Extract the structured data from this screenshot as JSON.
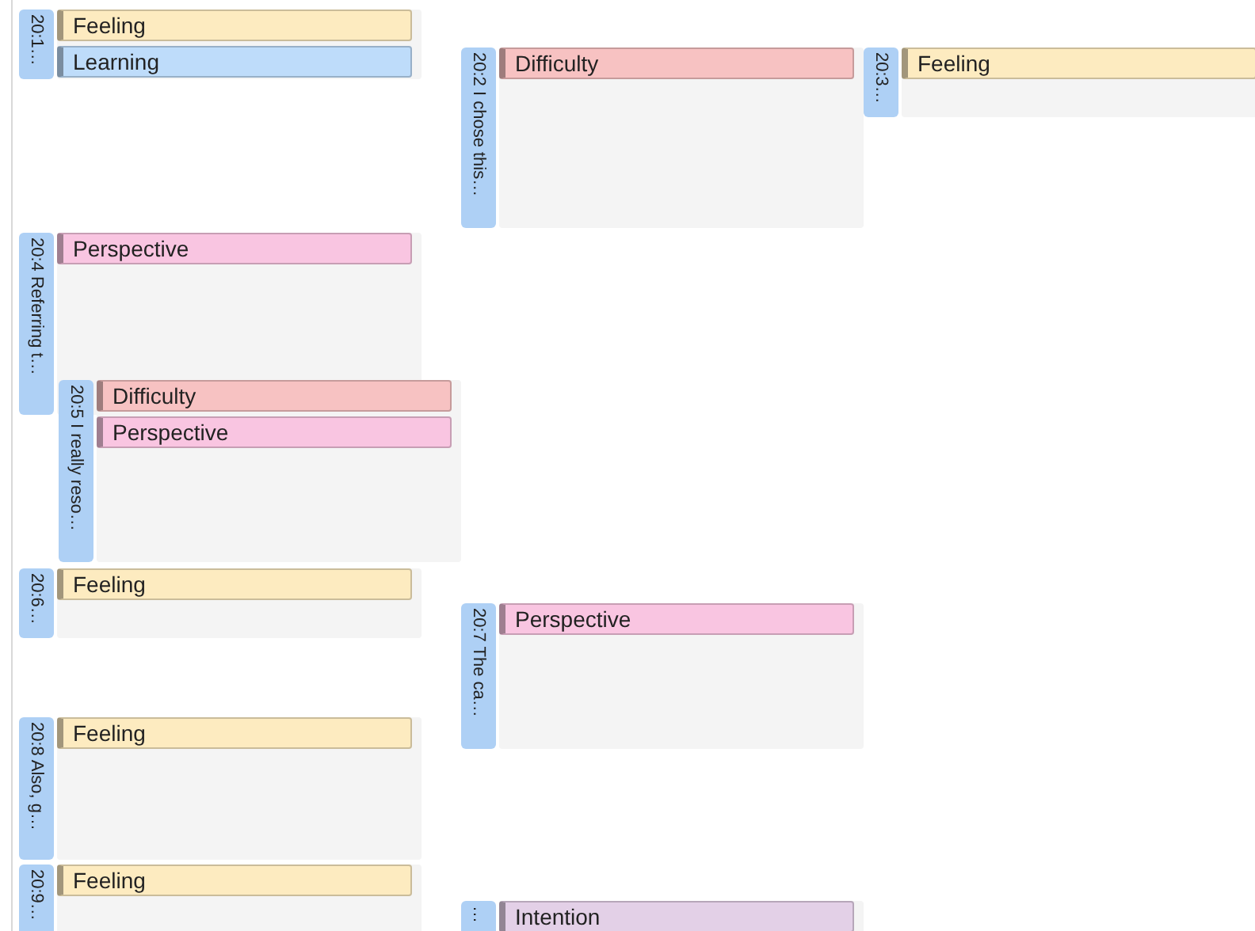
{
  "segments": [
    {
      "label": "20:1…",
      "codes": [
        {
          "name": "Feeling",
          "color": "#fdebc0"
        },
        {
          "name": "Learning",
          "color": "#bedcfa"
        }
      ]
    },
    {
      "label": "20:2 I chose this…",
      "codes": [
        {
          "name": "Difficulty",
          "color": "#f7c2c2"
        }
      ]
    },
    {
      "label": "20:3…",
      "codes": [
        {
          "name": "Feeling",
          "color": "#fdebc0"
        }
      ]
    },
    {
      "label": "20:4 Referring t…",
      "codes": [
        {
          "name": "Perspective",
          "color": "#f9c5e1"
        }
      ]
    },
    {
      "label": "20:5 I really reso…",
      "codes": [
        {
          "name": "Difficulty",
          "color": "#f7c2c2"
        },
        {
          "name": "Perspective",
          "color": "#f9c5e1"
        }
      ]
    },
    {
      "label": "20:6…",
      "codes": [
        {
          "name": "Feeling",
          "color": "#fdebc0"
        }
      ]
    },
    {
      "label": "20:7 The ca…",
      "codes": [
        {
          "name": "Perspective",
          "color": "#f9c5e1"
        }
      ]
    },
    {
      "label": "20:8 Also, g…",
      "codes": [
        {
          "name": "Feeling",
          "color": "#fdebc0"
        }
      ]
    },
    {
      "label": "20:9…",
      "codes": [
        {
          "name": "Feeling",
          "color": "#fdebc0"
        }
      ]
    },
    {
      "label": "…",
      "codes": [
        {
          "name": "Intention",
          "color": "#e3d0e7"
        }
      ]
    }
  ]
}
